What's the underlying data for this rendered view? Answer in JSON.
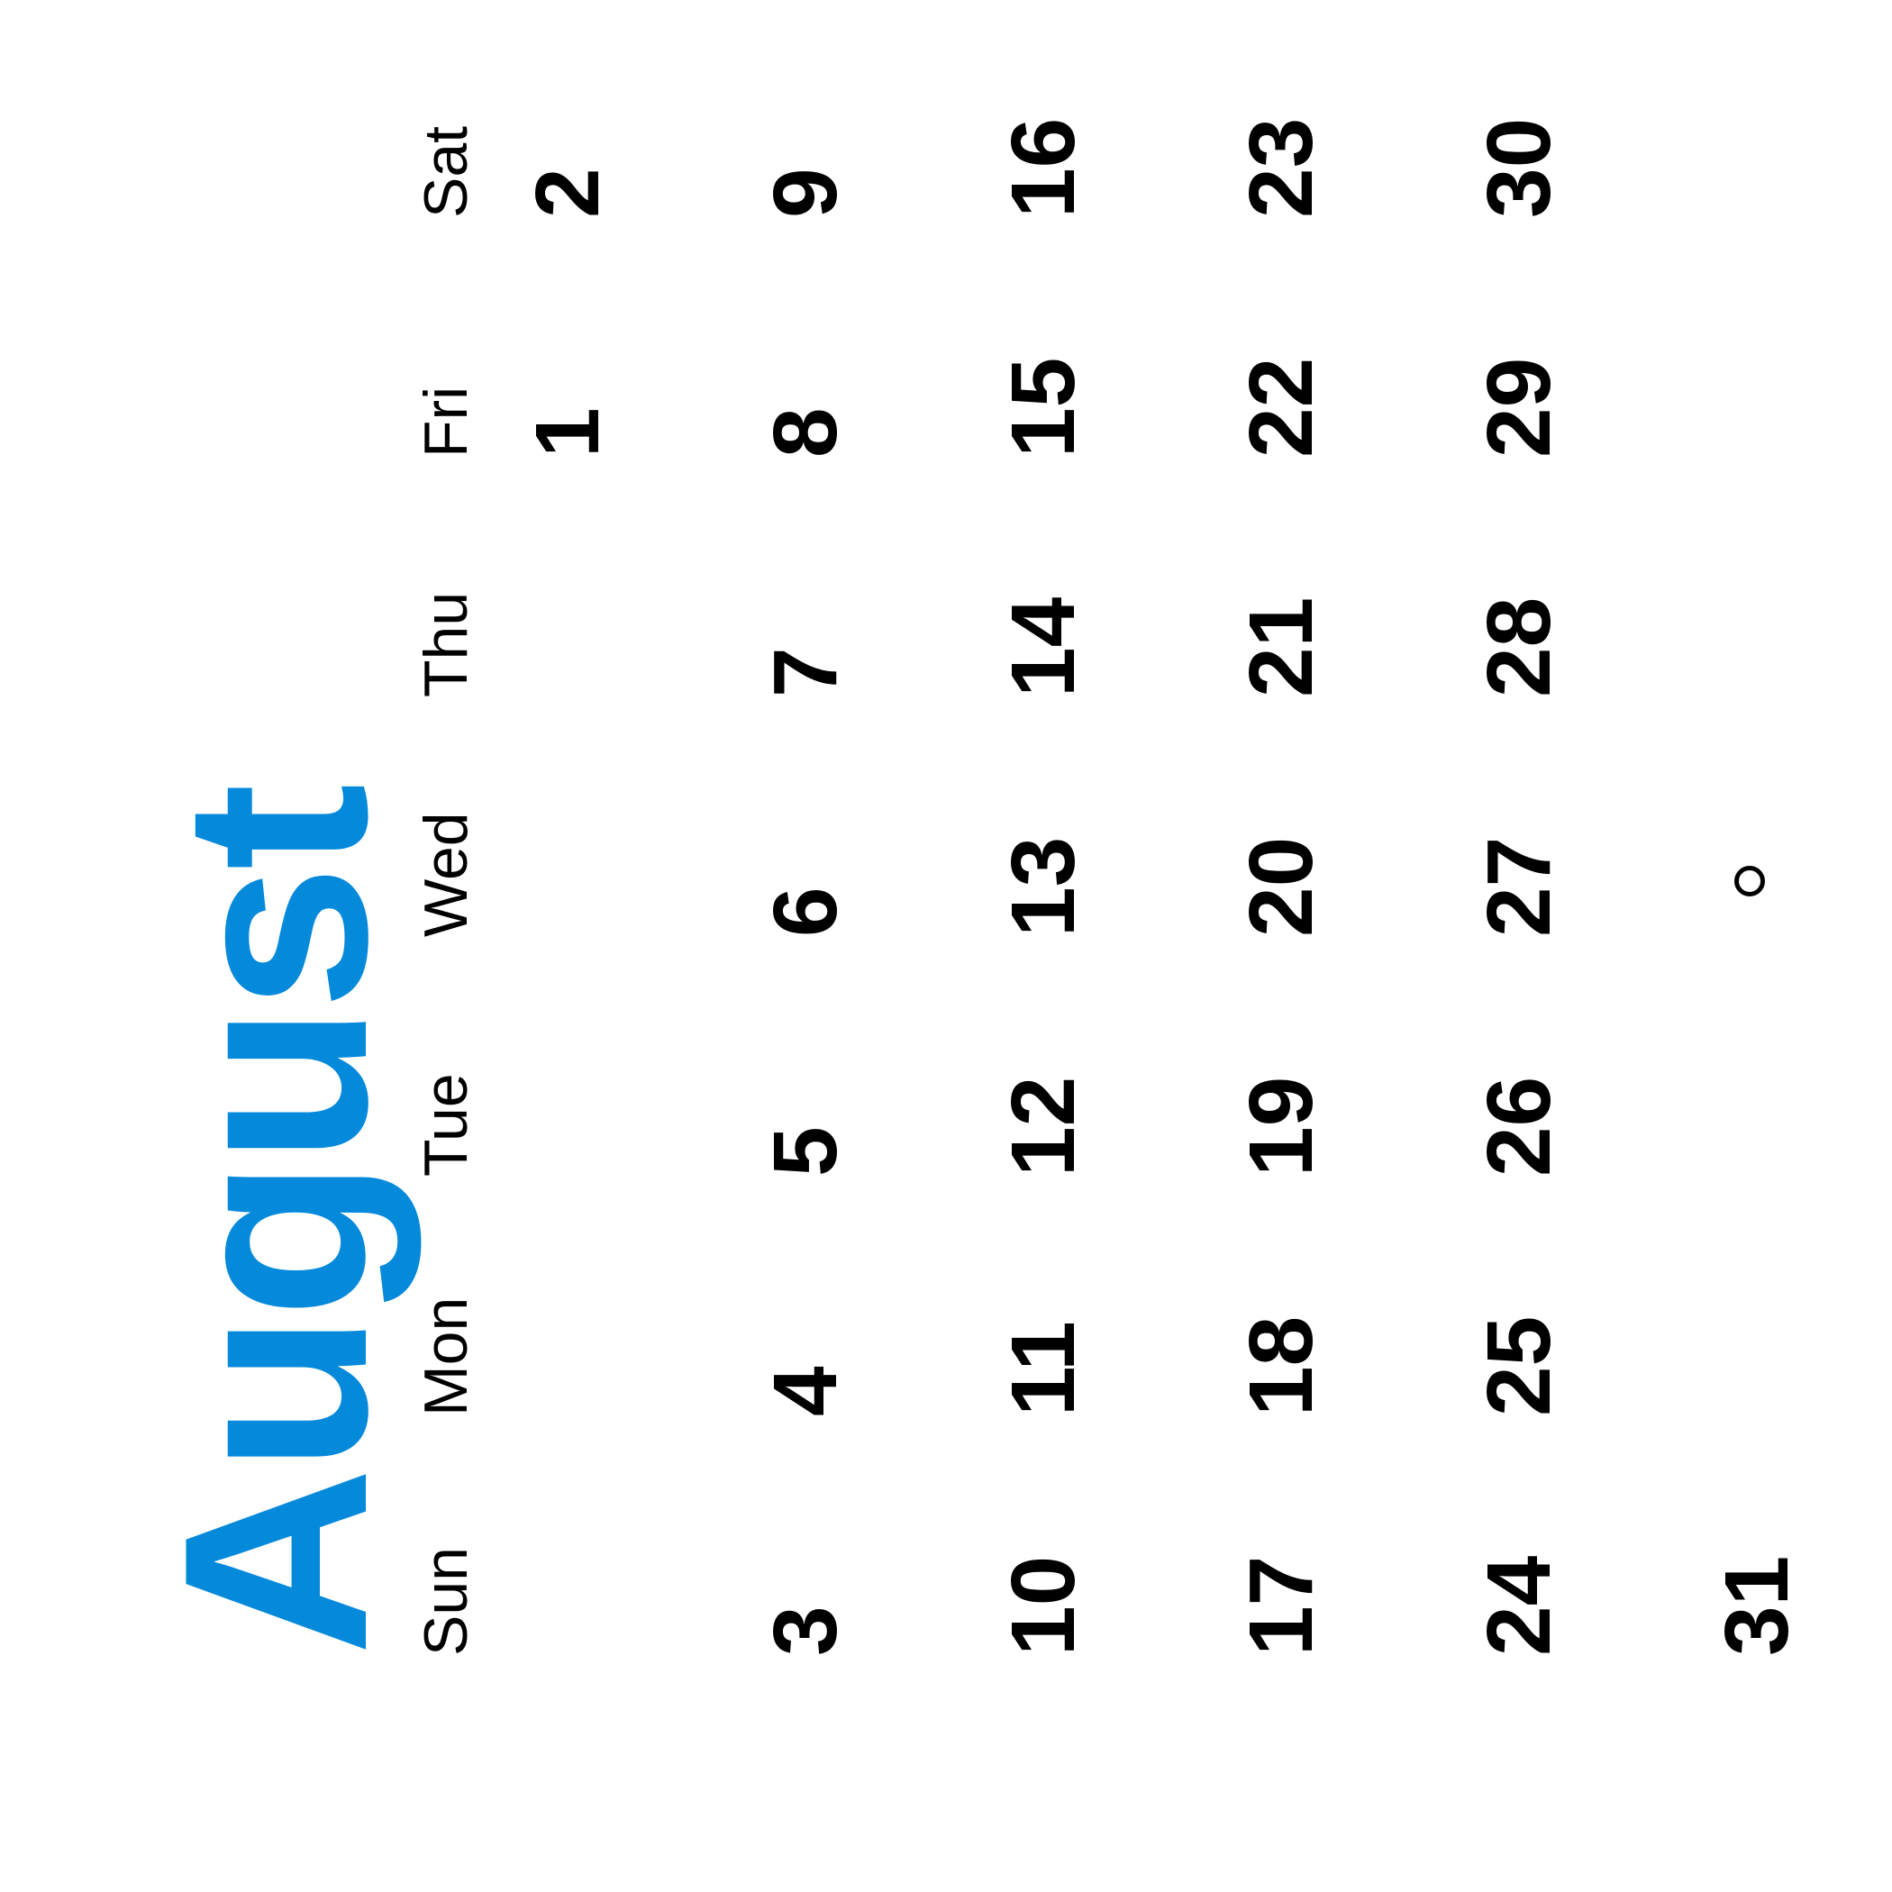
{
  "calendar": {
    "month": "August",
    "accent_color": "#0489DB",
    "weekdays": [
      "Sun",
      "Mon",
      "Tue",
      "Wed",
      "Thu",
      "Fri",
      "Sat"
    ],
    "weeks": [
      [
        "",
        "",
        "",
        "",
        "",
        "1",
        "2"
      ],
      [
        "3",
        "4",
        "5",
        "6",
        "7",
        "8",
        "9"
      ],
      [
        "10",
        "11",
        "12",
        "13",
        "14",
        "15",
        "16"
      ],
      [
        "17",
        "18",
        "19",
        "20",
        "21",
        "22",
        "23"
      ],
      [
        "24",
        "25",
        "26",
        "27",
        "28",
        "29",
        "30"
      ],
      [
        "31",
        "",
        "",
        "",
        "",
        "",
        ""
      ]
    ],
    "marker_icon": "circle-outline-icon"
  }
}
